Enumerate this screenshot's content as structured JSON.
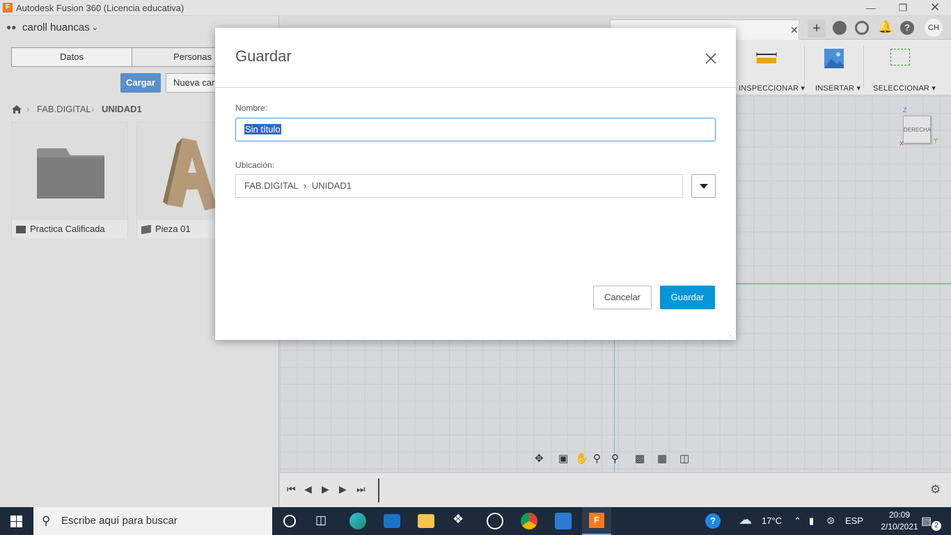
{
  "window": {
    "title": "Autodesk Fusion 360 (Licencia educativa)",
    "logo": "F"
  },
  "datapanel": {
    "user": "caroll huancas",
    "user_initials": "CH",
    "tabs": [
      "Datos",
      "Personas"
    ],
    "upload_label": "Cargar",
    "new_folder_label": "Nueva carp",
    "breadcrumb": [
      "FAB.DIGITAL",
      "UNIDAD1"
    ],
    "items": [
      {
        "name": "Practica Calificada",
        "type": "folder"
      },
      {
        "name": "Pieza 01",
        "type": "design"
      }
    ]
  },
  "toolbar": {
    "inspect": "INSPECCIONAR",
    "insert": "INSERTAR",
    "select": "SELECCIONAR"
  },
  "viewcube": {
    "face": "DERECHA",
    "axis_z": "Z",
    "axis_y": "Y",
    "axis_x": "X"
  },
  "dialog": {
    "title": "Guardar",
    "name_label": "Nombre:",
    "name_value": "Sin título",
    "location_label": "Ubicación:",
    "location_path": [
      "FAB.DIGITAL",
      "UNIDAD1"
    ],
    "cancel_label": "Cancelar",
    "save_label": "Guardar"
  },
  "taskbar": {
    "search_placeholder": "Escribe aquí para buscar",
    "temperature": "17°C",
    "language": "ESP",
    "time": "20:09",
    "date": "2/10/2021",
    "notifications": "2"
  },
  "colors": {
    "accent": "#0696d7",
    "upload": "#5a8fcb",
    "taskbar": "#1c2a3b",
    "selection": "#3168c3"
  }
}
